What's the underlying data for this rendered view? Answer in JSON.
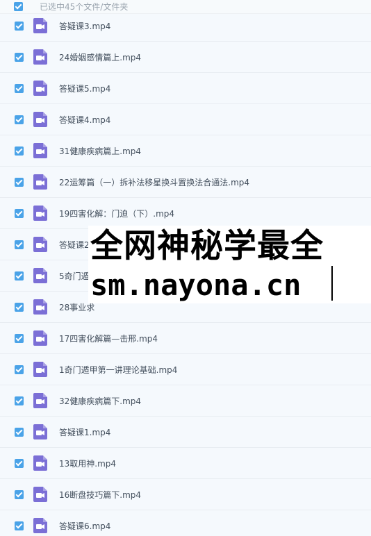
{
  "header": {
    "selection_text": "已选中45个文件/文件夹"
  },
  "files": [
    {
      "name": "答疑课3.mp4"
    },
    {
      "name": "24婚姻感情篇上.mp4"
    },
    {
      "name": "答疑课5.mp4"
    },
    {
      "name": "答疑课4.mp4"
    },
    {
      "name": "31健康疾病篇上.mp4"
    },
    {
      "name": "22运筹篇（一）拆补法移星换斗置换法合通法.mp4"
    },
    {
      "name": "19四害化解：门迫（下）.mp4"
    },
    {
      "name": "答疑课2"
    },
    {
      "name": "5奇门遁"
    },
    {
      "name": "28事业求"
    },
    {
      "name": "17四害化解篇—击邢.mp4"
    },
    {
      "name": "1奇门遁甲第一讲理论基础.mp4"
    },
    {
      "name": "32健康疾病篇下.mp4"
    },
    {
      "name": "答疑课1.mp4"
    },
    {
      "name": "13取用神.mp4"
    },
    {
      "name": "16断盘技巧篇下.mp4"
    },
    {
      "name": "答疑课6.mp4"
    }
  ],
  "watermark": {
    "line1": "全网神秘学最全",
    "line2": "sm.nayona.cn"
  },
  "colors": {
    "checkbox": "#4aa3e8",
    "video_icon": "#7b6fd6",
    "row_background": "#f5f9fd"
  },
  "icons": {
    "file_type": "video-file-icon",
    "checkbox": "checkmark-icon"
  }
}
